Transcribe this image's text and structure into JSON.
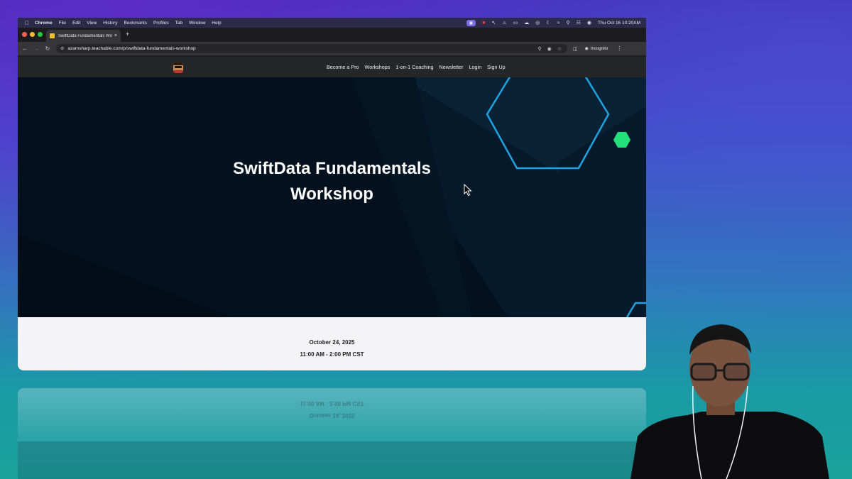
{
  "menubar": {
    "items": [
      "Chrome",
      "File",
      "Edit",
      "View",
      "History",
      "Bookmarks",
      "Profiles",
      "Tab",
      "Window",
      "Help"
    ],
    "datetime": "Thu Oct 16  10:20AM"
  },
  "browser": {
    "tab_title": "SwiftData Fundamentals Wo",
    "url": "azamsharp.teachable.com/p/swiftdata-fundamentals-workshop",
    "incognito_label": "Incognito"
  },
  "site": {
    "nav": [
      "Become a Pro",
      "Workshops",
      "1-on-1 Coaching",
      "Newsletter",
      "Login",
      "Sign Up"
    ],
    "hero_title_line1": "SwiftData Fundamentals",
    "hero_title_line2": "Workshop",
    "date": "October 24, 2025",
    "time": "11:00 AM - 2:00 PM CST"
  },
  "colors": {
    "hero_background": "#03111f",
    "hexagon_outline": "#1fa3e0",
    "hexagon_accent": "#23e07a"
  }
}
